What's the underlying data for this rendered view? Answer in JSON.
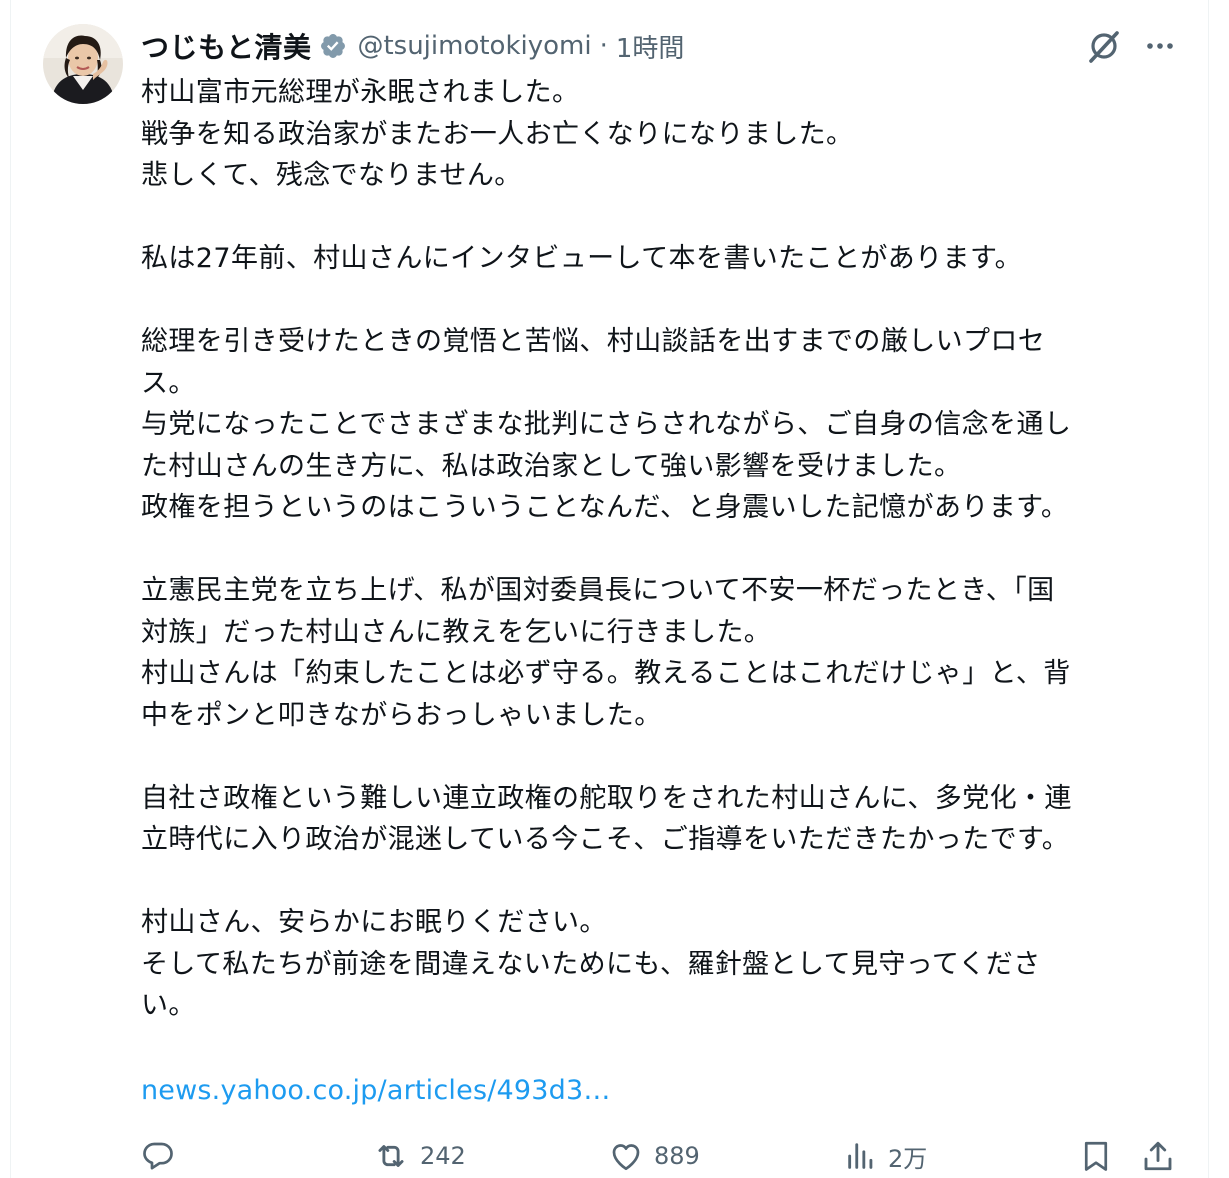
{
  "author": {
    "display_name": "つじもと清美",
    "handle": "@tsujimotokiyomi",
    "separator": "·",
    "time": "1時間"
  },
  "icons": {
    "verified": "verified-badge-icon",
    "grok": "grok-icon",
    "more": "more-icon",
    "reply": "reply-icon",
    "repost": "repost-icon",
    "like": "heart-icon",
    "views": "views-icon",
    "bookmark": "bookmark-icon",
    "share": "share-icon"
  },
  "colors": {
    "text": "#0f1419",
    "secondary": "#536471",
    "link": "#1d9bf0",
    "verified": "#829aab"
  },
  "tweet": {
    "paragraphs": [
      "村山富市元総理が永眠されました。\n戦争を知る政治家がまたお一人お亡くなりになりました。\n悲しくて、残念でなりません。",
      "私は27年前、村山さんにインタビューして本を書いたことがあります。",
      "総理を引き受けたときの覚悟と苦悩、村山談話を出すまでの厳しいプロセ\nス。\n与党になったことでさまざまな批判にさらされながら、ご自身の信念を通し\nた村山さんの生き方に、私は政治家として強い影響を受けました。\n政権を担うというのはこういうことなんだ、と身震いした記憶があります。",
      "立憲民主党を立ち上げ、私が国対委員長について不安一杯だったとき、「国\n対族」だった村山さんに教えを乞いに行きました。\n村山さんは「約束したことは必ず守る。教えることはこれだけじゃ」と、背\n中をポンと叩きながらおっしゃいました。",
      "自社さ政権という難しい連立政権の舵取りをされた村山さんに、多党化・連\n立時代に入り政治が混迷している今こそ、ご指導をいただきたかったです。",
      "村山さん、安らかにお眠りください。\nそして私たちが前途を間違えないためにも、羅針盤として見守ってくださ\nい。"
    ],
    "link_text": "news.yahoo.co.jp/articles/493d3…"
  },
  "actions": {
    "retweets": "242",
    "likes": "889",
    "views": "2万"
  }
}
